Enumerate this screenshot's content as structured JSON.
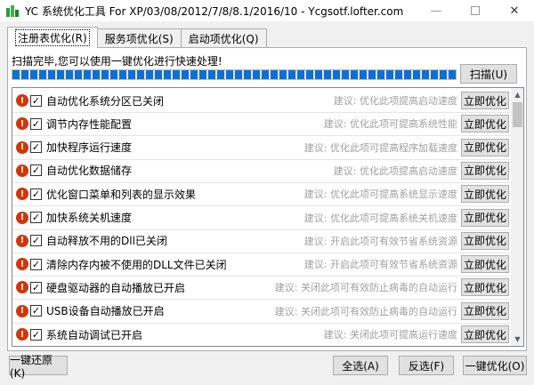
{
  "window": {
    "title": "YC 系统优化工具 For XP/03/08/2012/7/8/8.1/2016/10 - Ycgsotf.lofter.com",
    "minimize": "—",
    "close": "✕"
  },
  "tabs": [
    {
      "label": "注册表优化(R)"
    },
    {
      "label": "服务项优化(S)"
    },
    {
      "label": "启动项优化(Q)"
    }
  ],
  "status": {
    "message": "扫描完毕,您可以使用一键优化进行快速处理!",
    "progress": 1.0
  },
  "scan_label": "扫描(U)",
  "items": [
    {
      "label": "自动优化系统分区已关闭",
      "hint": "建议: 优化此项提高启动速度",
      "button": "立即优化"
    },
    {
      "label": "调节内存性能配置",
      "hint": "建议: 优化此项可提高系统性能",
      "button": "立即优化"
    },
    {
      "label": "加快程序运行速度",
      "hint": "建议: 优化此项可提高程序加载速度",
      "button": "立即优化"
    },
    {
      "label": "自动优化数据储存",
      "hint": "建议: 优化此项提高启动速度",
      "button": "立即优化"
    },
    {
      "label": "优化窗口菜单和列表的显示效果",
      "hint": "建议: 优化此项可提高系统显示速度",
      "button": "立即优化"
    },
    {
      "label": "加快系统关机速度",
      "hint": "建议: 优化此项可提高系统关机速度",
      "button": "立即优化"
    },
    {
      "label": "自动释放不用的Dll已关闭",
      "hint": "建议: 开启此项可有效节省系统资源",
      "button": "立即优化"
    },
    {
      "label": "清除内存内被不使用的DLL文件已关闭",
      "hint": "建议: 开启此项可有效节省系统资源",
      "button": "立即优化"
    },
    {
      "label": "硬盘驱动器的自动播放已开启",
      "hint": "建议: 关闭此项可有效防止病毒的自动运行",
      "button": "立即优化"
    },
    {
      "label": "USB设备自动播放已开启",
      "hint": "建议: 关闭此项可有效防止病毒的自动运行",
      "button": "立即优化"
    },
    {
      "label": "系统自动调试已开启",
      "hint": "建议: 关闭此项可提高运行速度",
      "button": "立即优化"
    }
  ],
  "footer": {
    "restore_label": "一键还原(K)",
    "selectall_label": "全选(A)",
    "invert_label": "反选(F)",
    "optimize_label": "一键优化(O)"
  },
  "colors": {
    "progress_fill": "#0a70d6",
    "warn_icon": "#d3350b",
    "hint_text": "#a0a0a0"
  }
}
